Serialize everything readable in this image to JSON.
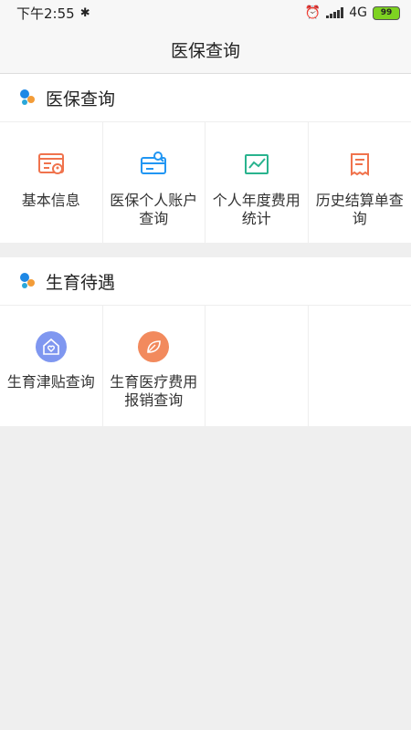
{
  "status_bar": {
    "time": "下午2:55",
    "network": "4G",
    "battery": "99"
  },
  "title_bar": {
    "title": "医保查询"
  },
  "sections": [
    {
      "title": "医保查询",
      "items": [
        {
          "label": "基本信息",
          "icon": "profile-card-icon"
        },
        {
          "label": "医保个人账户查询",
          "icon": "account-card-icon"
        },
        {
          "label": "个人年度费用统计",
          "icon": "trend-chart-icon"
        },
        {
          "label": "历史结算单查询",
          "icon": "receipt-icon"
        }
      ]
    },
    {
      "title": "生育待遇",
      "items": [
        {
          "label": "生育津贴查询",
          "icon": "home-heart-icon"
        },
        {
          "label": "生育医疗费用报销查询",
          "icon": "leaf-icon"
        }
      ]
    }
  ],
  "colors": {
    "orange": "#f0734d",
    "blue": "#2196f3",
    "green": "#29b38e",
    "purple": "#7f97f0",
    "orange_round": "#f28a5d"
  }
}
